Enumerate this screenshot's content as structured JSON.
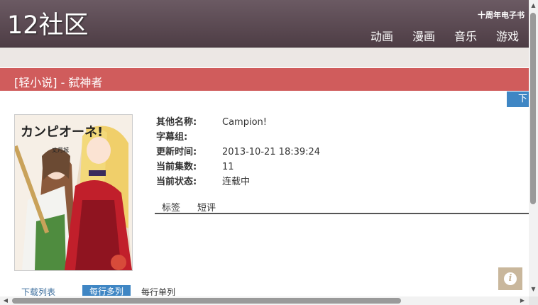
{
  "header": {
    "logo": "12社区",
    "slogan": "十周年电子书",
    "nav": [
      "动画",
      "漫画",
      "音乐",
      "游戏"
    ]
  },
  "page": {
    "title": "[轻小说] - 弑神者",
    "download_button": "下"
  },
  "details": [
    {
      "label": "其他名称:",
      "value": "Campion!"
    },
    {
      "label": "字幕组:",
      "value": ""
    },
    {
      "label": "更新时间:",
      "value": "2013-10-21 18:39:24"
    },
    {
      "label": "当前集数:",
      "value": "11"
    },
    {
      "label": "当前状态:",
      "value": "连载中"
    }
  ],
  "tabs": [
    "标签",
    "短评"
  ],
  "cover": {
    "title_text": "カンピオーネ!",
    "author_text": "丈月城"
  },
  "bottom_links": {
    "download_list": "下载列表",
    "per_row_many": "每行多列",
    "per_row_single": "每行单列"
  },
  "info_icon": "i",
  "colors": {
    "header": "#5a4852",
    "title_bar": "#d05c5c",
    "accent": "#3f86c4",
    "info_button": "#c9b79c"
  }
}
